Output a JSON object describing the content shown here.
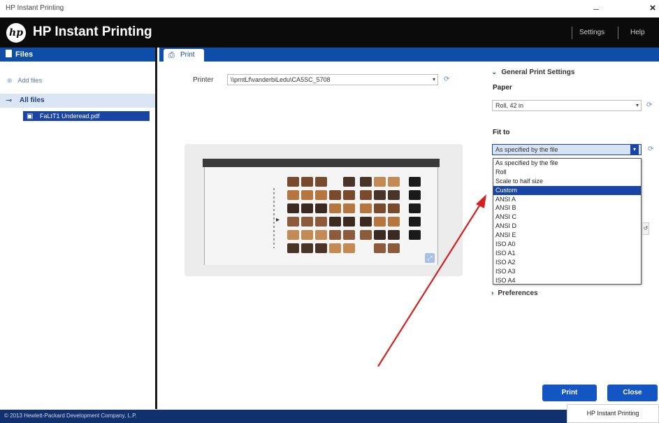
{
  "window": {
    "title": "HP Instant Printing",
    "minimize": "–",
    "close": "×"
  },
  "header": {
    "logo": "hp",
    "app_name": "HP Instant Printing",
    "settings": "Settings",
    "help": "Help"
  },
  "sidebar": {
    "title": "Files",
    "add_files": "Add files",
    "all_files": "All files",
    "file_item": "FaLtT1 Underead.pdf"
  },
  "tab": {
    "label": "Print"
  },
  "printer": {
    "label": "Printer",
    "value": "\\\\prntLf\\vanderbiLedu\\CA5SC_5708"
  },
  "settings": {
    "general_header": "General Print Settings",
    "paper_label": "Paper",
    "paper_value": "Roll, 42 in",
    "fit_label": "Fit to",
    "fit_value": "As specified by the file",
    "fit_options": [
      "As specified by the file",
      "Roll",
      "Scale to half size",
      "Custom",
      "ANSI A",
      "ANSI B",
      "ANSI C",
      "ANSI D",
      "ANSI E",
      "ISO A0",
      "ISO A1",
      "ISO A2",
      "ISO A3",
      "ISO A4"
    ],
    "fit_selected_index": 3,
    "preferences_header": "Preferences"
  },
  "buttons": {
    "print": "Print",
    "close": "Close"
  },
  "footer": {
    "copyright": "© 2013 Hewlett-Packard Development Company, L.P.",
    "taskbar_item": "HP Instant Printing"
  },
  "colors": {
    "accent": "#0f4ea8",
    "selection": "#1844a6",
    "header_bg": "#0b0b0b",
    "annotation_arrow": "#d42020"
  }
}
